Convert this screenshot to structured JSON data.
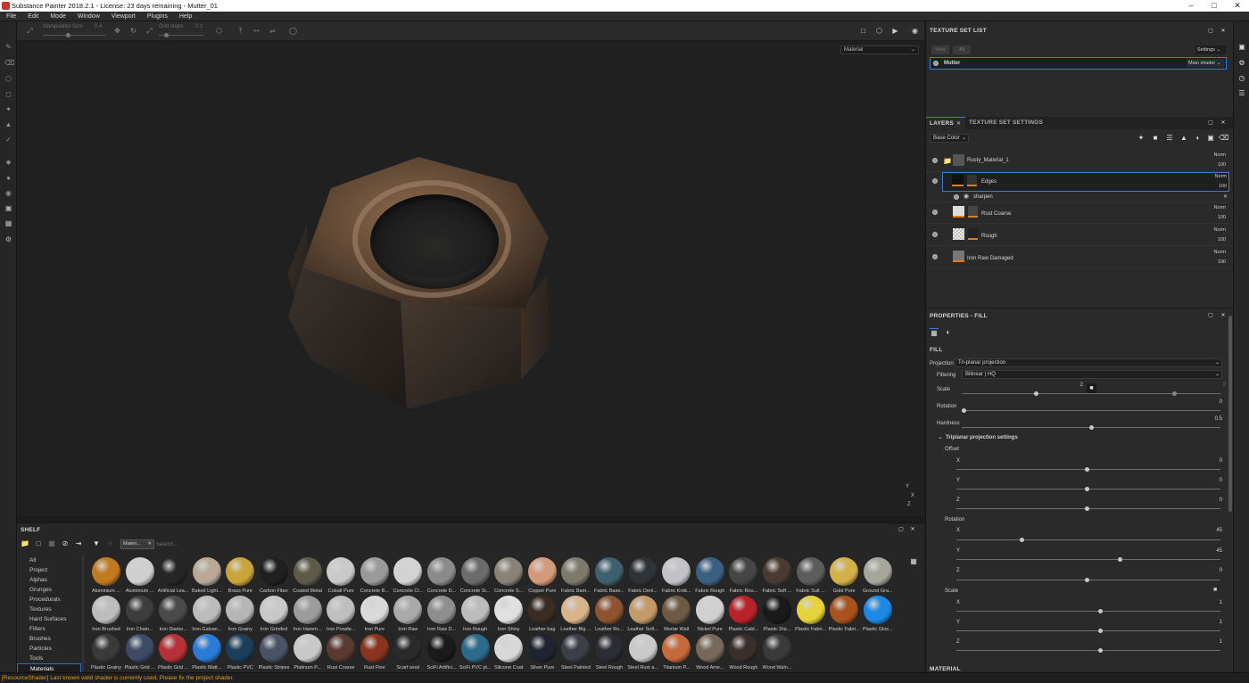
{
  "window": {
    "title": "Substance Painter 2018.2.1 - License: 23 days remaining - Mutter_01"
  },
  "menu": [
    "File",
    "Edit",
    "Mode",
    "Window",
    "Viewport",
    "Plugins",
    "Help"
  ],
  "toolbar": {
    "manipulator_label": "Manipulator Size",
    "manipulator_value": "0.4",
    "grid_label": "Grid steps",
    "grid_value": "0.1"
  },
  "viewport": {
    "display_mode": "Material"
  },
  "texture_set_list": {
    "title": "TEXTURE SET LIST",
    "btn_solo": "Solo",
    "btn_all": "All",
    "settings": "Settings",
    "item": "Mutter",
    "shader": "Main shader"
  },
  "layers": {
    "tab_layers": "LAYERS",
    "tab_tss": "TEXTURE SET SETTINGS",
    "channel": "Base Color",
    "items": [
      {
        "name": "Rusty_Material_1",
        "mode": "Norm",
        "opacity": "100"
      },
      {
        "name": "Edges",
        "mode": "Norm",
        "opacity": "100"
      },
      {
        "name": "sharpen"
      },
      {
        "name": "Rust Coarse",
        "mode": "Norm",
        "opacity": "100"
      },
      {
        "name": "Rough",
        "mode": "Norm",
        "opacity": "100"
      },
      {
        "name": "Iron Raw Damaged",
        "mode": "Norm",
        "opacity": "100"
      }
    ]
  },
  "properties": {
    "title": "PROPERTIES - FILL",
    "section": "FILL",
    "projection_label": "Projection",
    "projection_value": "Tri-planar projection",
    "filtering_label": "Filtering",
    "filtering_value": "Bilinear | HQ",
    "scale_label": "Scale",
    "scale_value": "2",
    "scale_value2": "2",
    "rotation_label": "Rotation",
    "rotation_value": "0",
    "hardness_label": "Hardness",
    "hardness_value": "0.5",
    "triplanar_title": "Triplanar projection settings",
    "offset_label": "Offset",
    "rotation2_label": "Rotation",
    "scale2_label": "Scale",
    "axes": [
      "X",
      "Y",
      "Z"
    ],
    "offset_values": [
      "0",
      "0",
      "0"
    ],
    "rotation_values": [
      "45",
      "45",
      "0"
    ],
    "scale_values": [
      "1",
      "1",
      "1"
    ],
    "material_label": "MATERIAL"
  },
  "shelf": {
    "title": "SHELF",
    "filter_chip": "Materi...",
    "search_placeholder": "Search...",
    "categories": [
      "All",
      "Project",
      "Alphas",
      "Grunges",
      "Procedurals",
      "Textures",
      "Hard Surfaces",
      "Filters",
      "Brushes",
      "Particles",
      "Tools",
      "Materials"
    ],
    "materials": [
      "Aluminium ...",
      "Aluminium ...",
      "Artificial Lea...",
      "Baked Light...",
      "Brass Pure",
      "Carbon Fiber",
      "Coated Metal",
      "Cobalt Pure",
      "Concrete B...",
      "Concrete Cl...",
      "Concrete D...",
      "Concrete Si...",
      "Concrete S...",
      "Copper Pure",
      "Fabric Bam...",
      "Fabric Base...",
      "Fabric Deni...",
      "Fabric Knitt...",
      "Fabric Rough",
      "Fabric Rou...",
      "Fabric Soft ...",
      "Fabric Suit ...",
      "Gold Pure",
      "Ground Gra...",
      "Iron Brushed",
      "Iron Chain...",
      "Iron Diamo...",
      "Iron Galvan...",
      "Iron Grainy",
      "Iron Grinded",
      "Iron Hamm...",
      "Iron Powde...",
      "Iron Pure",
      "Iron Raw",
      "Iron Raw D...",
      "Iron Rough",
      "Iron Shiny",
      "Leather bag",
      "Leather Big ...",
      "Leather Ro...",
      "Leather Soft...",
      "Mortar Wall",
      "Nickel Pure",
      "Plastic Cabl...",
      "Plastic Dia...",
      "Plastic Fabri...",
      "Plastic Fabri...",
      "Plastic Glos...",
      "Plastic Grainy",
      "Plastic Grid ...",
      "Plastic Grid ...",
      "Plastic Matt...",
      "Plastic PVC",
      "Plastic Stripes",
      "Platinum P...",
      "Rust Coarse",
      "Rust Fine",
      "Scarf wool",
      "SciFi Artifici...",
      "SciFi PVC pl...",
      "Silicone Coat",
      "Silver Pure",
      "Steel Painted",
      "Steel Rough",
      "Steel Rust a...",
      "Titanium P...",
      "Wood Ame...",
      "Wood Rough",
      "Wood Waln..."
    ],
    "colors": [
      "#c17a1e",
      "#cfcfcf",
      "#262626",
      "#b9a896",
      "#c9a43a",
      "#202020",
      "#5d5a48",
      "#c9c9c9",
      "#9a9a9a",
      "#d3d3d3",
      "#8a8a8a",
      "#6b6b6b",
      "#8a8276",
      "#d49a7a",
      "#7d7a6b",
      "#3e5f6e",
      "#2e3338",
      "#c2c2c8",
      "#3b5f80",
      "#454545",
      "#4a3a33",
      "#5c5c5c",
      "#d3b04a",
      "#a6a69c",
      "#bdbdbd",
      "#3d3d3d",
      "#4a4a4a",
      "#bcbcbc",
      "#b6b6b6",
      "#c8c8c8",
      "#9c9c9c",
      "#bfbfbf",
      "#d9d9d9",
      "#a9a9a9",
      "#8e8e8e",
      "#bcbcbc",
      "#e0e0e0",
      "#3a2c24",
      "#d7b48a",
      "#8e5330",
      "#c49a6a",
      "#6d5a44",
      "#d0d0d0",
      "#b8232a",
      "#1a1a1a",
      "#e6d23a",
      "#a8521e",
      "#1e88e5",
      "#3a3a3a",
      "#3d4a66",
      "#b8313a",
      "#2a7bd6",
      "#1b3e5a",
      "#4a5366",
      "#c8c8c8",
      "#5a3a30",
      "#8a3420",
      "#2a2a2a",
      "#1a1a1a",
      "#2b6a8a",
      "#d8d8d8",
      "#1f2430",
      "#3a3f48",
      "#2a2d33",
      "#c9c9c9",
      "#c56a3a",
      "#77685a",
      "#3a2f2a",
      "#3a3a3a"
    ]
  },
  "status": {
    "message": "[ResourceShader] Last known valid shader is currently used. Please fix the project shader."
  }
}
